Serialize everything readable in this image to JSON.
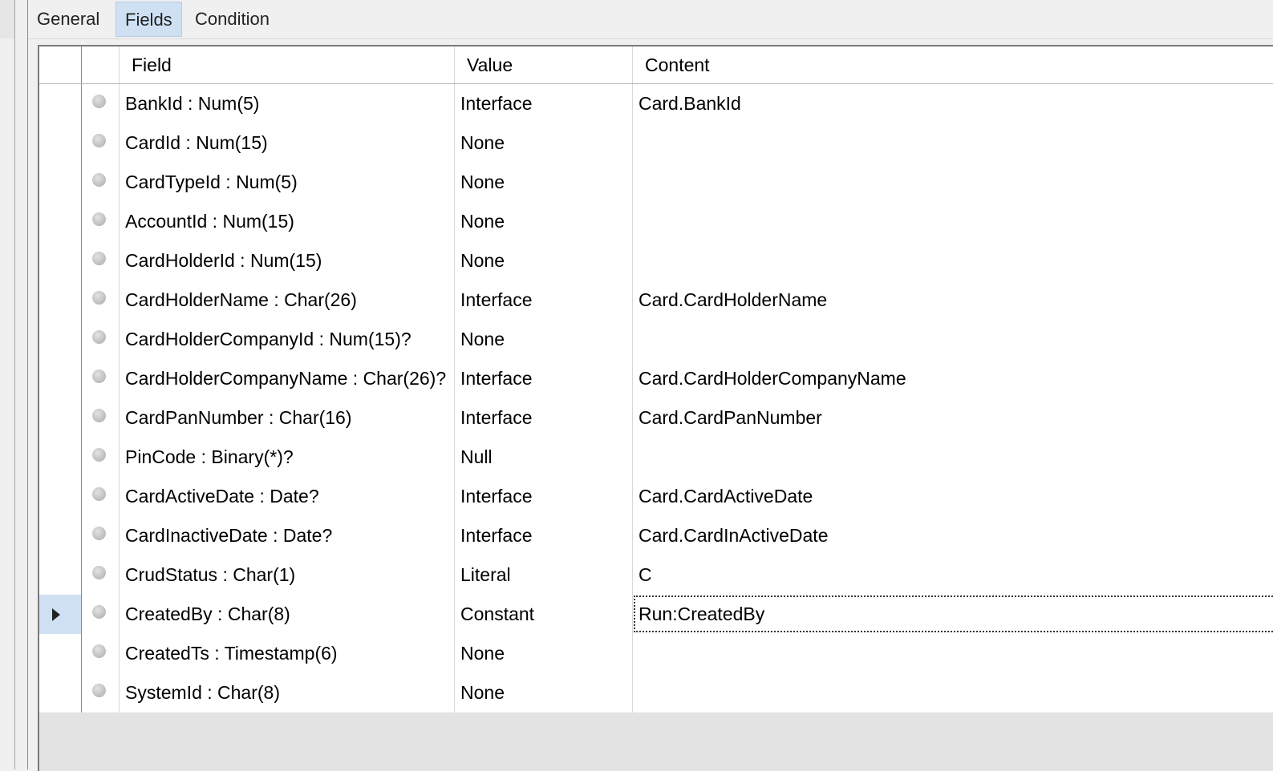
{
  "tabs": [
    {
      "label": "General"
    },
    {
      "label": "Fields",
      "active": true
    },
    {
      "label": "Condition"
    }
  ],
  "columns": {
    "field": "Field",
    "value": "Value",
    "content": "Content"
  },
  "rows": [
    {
      "field": "BankId : Num(5)",
      "value": "Interface",
      "content": "Card.BankId"
    },
    {
      "field": "CardId : Num(15)",
      "value": "None",
      "content": ""
    },
    {
      "field": "CardTypeId : Num(5)",
      "value": "None",
      "content": ""
    },
    {
      "field": "AccountId : Num(15)",
      "value": "None",
      "content": ""
    },
    {
      "field": "CardHolderId : Num(15)",
      "value": "None",
      "content": ""
    },
    {
      "field": "CardHolderName : Char(26)",
      "value": "Interface",
      "content": "Card.CardHolderName"
    },
    {
      "field": "CardHolderCompanyId : Num(15)?",
      "value": "None",
      "content": ""
    },
    {
      "field": "CardHolderCompanyName : Char(26)?",
      "value": "Interface",
      "content": "Card.CardHolderCompanyName"
    },
    {
      "field": "CardPanNumber : Char(16)",
      "value": "Interface",
      "content": "Card.CardPanNumber"
    },
    {
      "field": "PinCode : Binary(*)?",
      "value": "Null",
      "content": ""
    },
    {
      "field": "CardActiveDate : Date?",
      "value": "Interface",
      "content": "Card.CardActiveDate"
    },
    {
      "field": "CardInactiveDate : Date?",
      "value": "Interface",
      "content": "Card.CardInActiveDate"
    },
    {
      "field": "CrudStatus : Char(1)",
      "value": "Literal",
      "content": "C"
    },
    {
      "field": "CreatedBy : Char(8)",
      "value": "Constant",
      "content": "Run:CreatedBy",
      "current": true
    },
    {
      "field": "CreatedTs : Timestamp(6)",
      "value": "None",
      "content": ""
    },
    {
      "field": "SystemId : Char(8)",
      "value": "None",
      "content": ""
    }
  ],
  "colors": {
    "selection": "#cfe0f3",
    "background": "#f0f0f0"
  }
}
